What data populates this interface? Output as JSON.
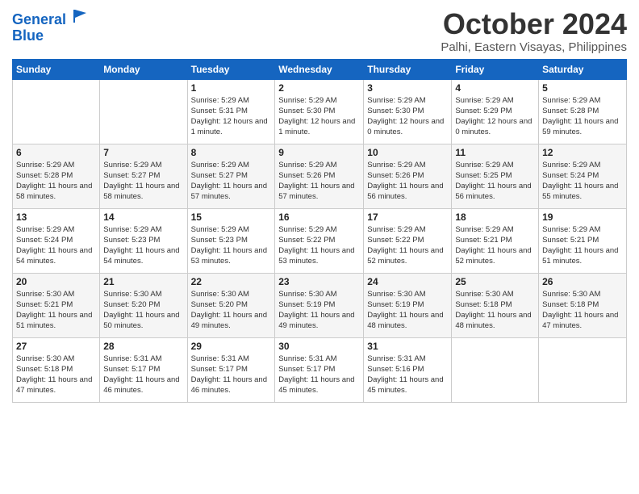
{
  "logo": {
    "line1": "General",
    "line2": "Blue"
  },
  "title": "October 2024",
  "location": "Palhi, Eastern Visayas, Philippines",
  "days_of_week": [
    "Sunday",
    "Monday",
    "Tuesday",
    "Wednesday",
    "Thursday",
    "Friday",
    "Saturday"
  ],
  "weeks": [
    [
      {
        "day": "",
        "info": ""
      },
      {
        "day": "",
        "info": ""
      },
      {
        "day": "1",
        "info": "Sunrise: 5:29 AM\nSunset: 5:31 PM\nDaylight: 12 hours and 1 minute."
      },
      {
        "day": "2",
        "info": "Sunrise: 5:29 AM\nSunset: 5:30 PM\nDaylight: 12 hours and 1 minute."
      },
      {
        "day": "3",
        "info": "Sunrise: 5:29 AM\nSunset: 5:30 PM\nDaylight: 12 hours and 0 minutes."
      },
      {
        "day": "4",
        "info": "Sunrise: 5:29 AM\nSunset: 5:29 PM\nDaylight: 12 hours and 0 minutes."
      },
      {
        "day": "5",
        "info": "Sunrise: 5:29 AM\nSunset: 5:28 PM\nDaylight: 11 hours and 59 minutes."
      }
    ],
    [
      {
        "day": "6",
        "info": "Sunrise: 5:29 AM\nSunset: 5:28 PM\nDaylight: 11 hours and 58 minutes."
      },
      {
        "day": "7",
        "info": "Sunrise: 5:29 AM\nSunset: 5:27 PM\nDaylight: 11 hours and 58 minutes."
      },
      {
        "day": "8",
        "info": "Sunrise: 5:29 AM\nSunset: 5:27 PM\nDaylight: 11 hours and 57 minutes."
      },
      {
        "day": "9",
        "info": "Sunrise: 5:29 AM\nSunset: 5:26 PM\nDaylight: 11 hours and 57 minutes."
      },
      {
        "day": "10",
        "info": "Sunrise: 5:29 AM\nSunset: 5:26 PM\nDaylight: 11 hours and 56 minutes."
      },
      {
        "day": "11",
        "info": "Sunrise: 5:29 AM\nSunset: 5:25 PM\nDaylight: 11 hours and 56 minutes."
      },
      {
        "day": "12",
        "info": "Sunrise: 5:29 AM\nSunset: 5:24 PM\nDaylight: 11 hours and 55 minutes."
      }
    ],
    [
      {
        "day": "13",
        "info": "Sunrise: 5:29 AM\nSunset: 5:24 PM\nDaylight: 11 hours and 54 minutes."
      },
      {
        "day": "14",
        "info": "Sunrise: 5:29 AM\nSunset: 5:23 PM\nDaylight: 11 hours and 54 minutes."
      },
      {
        "day": "15",
        "info": "Sunrise: 5:29 AM\nSunset: 5:23 PM\nDaylight: 11 hours and 53 minutes."
      },
      {
        "day": "16",
        "info": "Sunrise: 5:29 AM\nSunset: 5:22 PM\nDaylight: 11 hours and 53 minutes."
      },
      {
        "day": "17",
        "info": "Sunrise: 5:29 AM\nSunset: 5:22 PM\nDaylight: 11 hours and 52 minutes."
      },
      {
        "day": "18",
        "info": "Sunrise: 5:29 AM\nSunset: 5:21 PM\nDaylight: 11 hours and 52 minutes."
      },
      {
        "day": "19",
        "info": "Sunrise: 5:29 AM\nSunset: 5:21 PM\nDaylight: 11 hours and 51 minutes."
      }
    ],
    [
      {
        "day": "20",
        "info": "Sunrise: 5:30 AM\nSunset: 5:21 PM\nDaylight: 11 hours and 51 minutes."
      },
      {
        "day": "21",
        "info": "Sunrise: 5:30 AM\nSunset: 5:20 PM\nDaylight: 11 hours and 50 minutes."
      },
      {
        "day": "22",
        "info": "Sunrise: 5:30 AM\nSunset: 5:20 PM\nDaylight: 11 hours and 49 minutes."
      },
      {
        "day": "23",
        "info": "Sunrise: 5:30 AM\nSunset: 5:19 PM\nDaylight: 11 hours and 49 minutes."
      },
      {
        "day": "24",
        "info": "Sunrise: 5:30 AM\nSunset: 5:19 PM\nDaylight: 11 hours and 48 minutes."
      },
      {
        "day": "25",
        "info": "Sunrise: 5:30 AM\nSunset: 5:18 PM\nDaylight: 11 hours and 48 minutes."
      },
      {
        "day": "26",
        "info": "Sunrise: 5:30 AM\nSunset: 5:18 PM\nDaylight: 11 hours and 47 minutes."
      }
    ],
    [
      {
        "day": "27",
        "info": "Sunrise: 5:30 AM\nSunset: 5:18 PM\nDaylight: 11 hours and 47 minutes."
      },
      {
        "day": "28",
        "info": "Sunrise: 5:31 AM\nSunset: 5:17 PM\nDaylight: 11 hours and 46 minutes."
      },
      {
        "day": "29",
        "info": "Sunrise: 5:31 AM\nSunset: 5:17 PM\nDaylight: 11 hours and 46 minutes."
      },
      {
        "day": "30",
        "info": "Sunrise: 5:31 AM\nSunset: 5:17 PM\nDaylight: 11 hours and 45 minutes."
      },
      {
        "day": "31",
        "info": "Sunrise: 5:31 AM\nSunset: 5:16 PM\nDaylight: 11 hours and 45 minutes."
      },
      {
        "day": "",
        "info": ""
      },
      {
        "day": "",
        "info": ""
      }
    ]
  ]
}
